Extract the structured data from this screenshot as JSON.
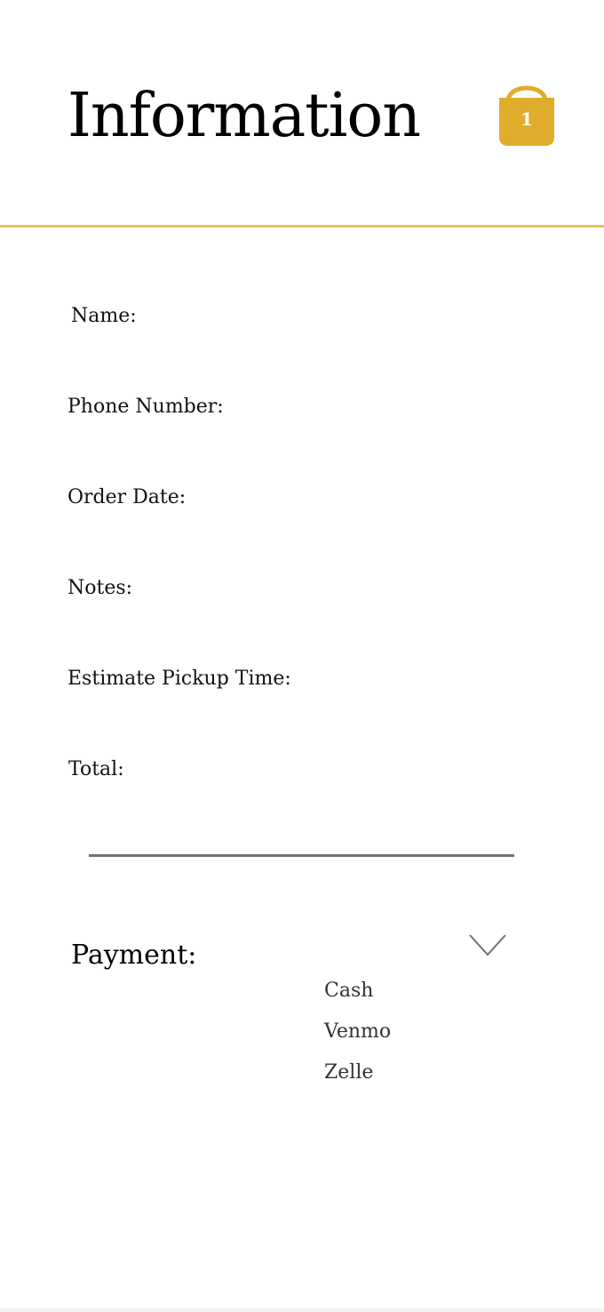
{
  "header": {
    "title": "Information",
    "cart_count": "1",
    "cart_icon": "shopping-bag-icon",
    "accent_color": "#E0AC2C",
    "divider_color": "#E2C35A"
  },
  "form": {
    "fields": [
      {
        "label": "Name:"
      },
      {
        "label": "Phone Number:"
      },
      {
        "label": "Order Date:"
      },
      {
        "label": "Notes:"
      },
      {
        "label": "Estimate Pickup Time:"
      },
      {
        "label": "Total:"
      }
    ]
  },
  "payment": {
    "label": "Payment:",
    "toggle_icon": "chevron-down-icon",
    "options": [
      "Cash",
      "Venmo",
      "Zelle"
    ]
  }
}
